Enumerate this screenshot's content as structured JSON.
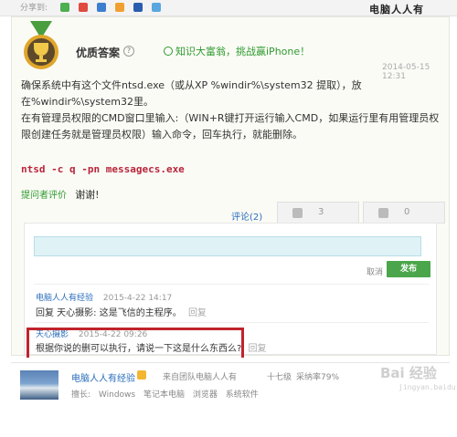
{
  "topbar": {
    "share_label": "分享到:",
    "watermark": "电脑人人有",
    "share_icons": [
      {
        "name": "green",
        "color": "#4caf50"
      },
      {
        "name": "red",
        "color": "#e04a3f"
      },
      {
        "name": "blue",
        "color": "#3b7ecf"
      },
      {
        "name": "orange",
        "color": "#f0a030"
      },
      {
        "name": "darkblue",
        "color": "#2a5db0"
      },
      {
        "name": "lightblue",
        "color": "#5aa7e0"
      }
    ]
  },
  "answer": {
    "best_label": "优质答案",
    "promo": "知识大富翁，挑战赢iPhone！",
    "date": "2014-05-15 12:31",
    "para1": "确保系统中有这个文件ntsd.exe（或从XP %windir%\\system32 提取），放在%windir%\\system32里。",
    "para2": "在有管理员权限的CMD窗口里输入:（WIN+R键打开运行输入CMD，如果运行里有用管理员权限创建任务就是管理员权限）输入命令，回车执行，就能删除。",
    "command": "ntsd -c q -pn messagecs.exe",
    "thanks_label": "提问者评价",
    "thanks_text": "谢谢!",
    "comments_link": "评论(2)",
    "upvotes": "3",
    "downvotes": "0"
  },
  "comment_box": {
    "cancel": "取消",
    "publish": "发布",
    "comments": [
      {
        "author": "电脑人人有经验",
        "date": "2015-4-22 14:17",
        "prefix": "回复 天心摄影:",
        "text": "这是飞信的主程序。",
        "reply": "回复"
      },
      {
        "author": "天心摄影",
        "date": "2015-4-22 09:26",
        "prefix": "",
        "text": "根据你说的删可以执行，请说一下这是什么东西么?",
        "reply": "回复"
      }
    ]
  },
  "footer": {
    "name": "电脑人人有经验",
    "team": "来自团队电脑人人有",
    "level": "十七级",
    "rate": "采纳率79%",
    "skills_label": "擅长:",
    "skills": [
      "Windows",
      "笔记本电脑",
      "浏览器",
      "系统软件"
    ],
    "watermark": "Bai 经验",
    "watermark_sub": "jingyan.baidu.com"
  }
}
